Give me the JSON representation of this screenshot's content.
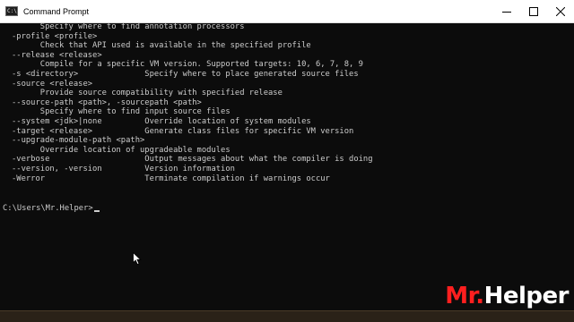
{
  "window": {
    "title": "Command Prompt",
    "icon": "cmd-icon",
    "icon_text": "C:\\"
  },
  "controls": [
    "minimize-icon",
    "maximize-icon",
    "close-icon"
  ],
  "console": {
    "lines": [
      "      Specify where to find annotation processors",
      "-profile <profile>",
      "      Check that API used is available in the specified profile",
      "--release <release>",
      "      Compile for a specific VM version. Supported targets: 10, 6, 7, 8, 9",
      "-s <directory>              Specify where to place generated source files",
      "-source <release>",
      "      Provide source compatibility with specified release",
      "--source-path <path>, -sourcepath <path>",
      "      Specify where to find input source files",
      "--system <jdk>|none         Override location of system modules",
      "-target <release>           Generate class files for specific VM version",
      "--upgrade-module-path <path>",
      "      Override location of upgradeable modules",
      "-verbose                    Output messages about what the compiler is doing",
      "--version, -version         Version information",
      "-Werror                     Terminate compilation if warnings occur"
    ],
    "prompt": "C:\\Users\\Mr.Helper>"
  },
  "watermark": {
    "part1": "Mr.",
    "part2": "Helper"
  },
  "colors": {
    "console_bg": "#0c0c0c",
    "console_fg": "#cccccc",
    "titlebar_bg": "#ffffff",
    "watermark_red": "#ff1f1f",
    "watermark_white": "#ffffff"
  }
}
